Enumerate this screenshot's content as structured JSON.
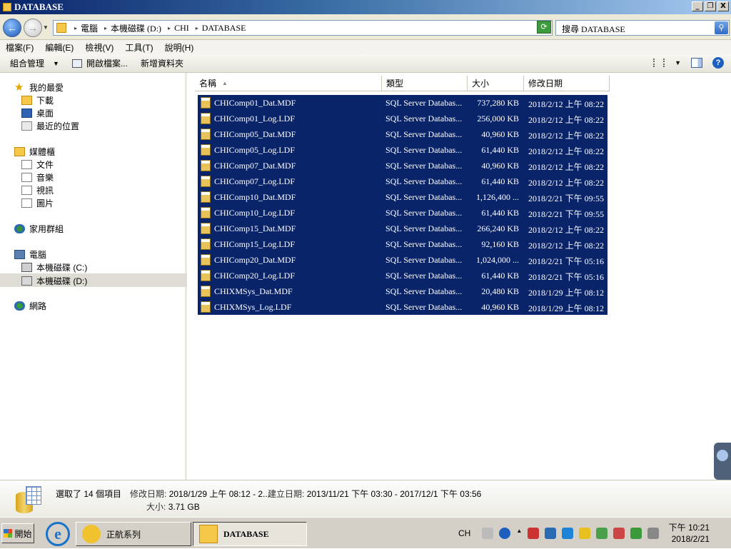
{
  "window": {
    "title": "DATABASE",
    "buttons": [
      "_",
      "❐",
      "X"
    ]
  },
  "address": {
    "crumbs": [
      "電腦",
      "本機磁碟 (D:)",
      "CHI",
      "DATABASE"
    ],
    "search_placeholder": "搜尋 DATABASE"
  },
  "menu": [
    "檔案(F)",
    "編輯(E)",
    "檢視(V)",
    "工具(T)",
    "說明(H)"
  ],
  "commands": {
    "organize": "組合管理",
    "open": "開啟檔案...",
    "new_folder": "新增資料夾"
  },
  "nav": {
    "favorites": "我的最愛",
    "downloads": "下載",
    "desktop": "桌面",
    "recent": "最近的位置",
    "libraries": "媒體櫃",
    "documents": "文件",
    "music": "音樂",
    "videos": "視訊",
    "pictures": "圖片",
    "homegroup": "家用群組",
    "computer": "電腦",
    "drive_c": "本機磁碟 (C:)",
    "drive_d": "本機磁碟 (D:)",
    "network": "網路"
  },
  "columns": {
    "name": "名稱",
    "type": "類型",
    "size": "大小",
    "modified": "修改日期"
  },
  "files": [
    {
      "name": "CHIComp01_Dat.MDF",
      "type": "SQL Server Databas...",
      "size": "737,280 KB",
      "modified": "2018/2/12 上午 08:22"
    },
    {
      "name": "CHIComp01_Log.LDF",
      "type": "SQL Server Databas...",
      "size": "256,000 KB",
      "modified": "2018/2/12 上午 08:22"
    },
    {
      "name": "CHIComp05_Dat.MDF",
      "type": "SQL Server Databas...",
      "size": "40,960 KB",
      "modified": "2018/2/12 上午 08:22"
    },
    {
      "name": "CHIComp05_Log.LDF",
      "type": "SQL Server Databas...",
      "size": "61,440 KB",
      "modified": "2018/2/12 上午 08:22"
    },
    {
      "name": "CHIComp07_Dat.MDF",
      "type": "SQL Server Databas...",
      "size": "40,960 KB",
      "modified": "2018/2/12 上午 08:22"
    },
    {
      "name": "CHIComp07_Log.LDF",
      "type": "SQL Server Databas...",
      "size": "61,440 KB",
      "modified": "2018/2/12 上午 08:22"
    },
    {
      "name": "CHIComp10_Dat.MDF",
      "type": "SQL Server Databas...",
      "size": "1,126,400 ...",
      "modified": "2018/2/21 下午 09:55"
    },
    {
      "name": "CHIComp10_Log.LDF",
      "type": "SQL Server Databas...",
      "size": "61,440 KB",
      "modified": "2018/2/21 下午 09:55"
    },
    {
      "name": "CHIComp15_Dat.MDF",
      "type": "SQL Server Databas...",
      "size": "266,240 KB",
      "modified": "2018/2/12 上午 08:22"
    },
    {
      "name": "CHIComp15_Log.LDF",
      "type": "SQL Server Databas...",
      "size": "92,160 KB",
      "modified": "2018/2/12 上午 08:22"
    },
    {
      "name": "CHIComp20_Dat.MDF",
      "type": "SQL Server Databas...",
      "size": "1,024,000 ...",
      "modified": "2018/2/21 下午 05:16"
    },
    {
      "name": "CHIComp20_Log.LDF",
      "type": "SQL Server Databas...",
      "size": "61,440 KB",
      "modified": "2018/2/21 下午 05:16"
    },
    {
      "name": "CHIXMSys_Dat.MDF",
      "type": "SQL Server Databas...",
      "size": "20,480 KB",
      "modified": "2018/1/29 上午 08:12"
    },
    {
      "name": "CHIXMSys_Log.LDF",
      "type": "SQL Server Databas...",
      "size": "40,960 KB",
      "modified": "2018/1/29 上午 08:12"
    }
  ],
  "details": {
    "selected": "選取了 14 個項目",
    "modified_label": "修改日期:",
    "modified_value": "2018/1/29 上午 08:12 - 2...",
    "created_label": "建立日期:",
    "created_value": "2013/11/21 下午 03:30 - 2017/12/1 下午 03:56",
    "size_label": "大小:",
    "size_value": "3.71 GB"
  },
  "taskbar": {
    "start": "開始",
    "app1": "正航系列",
    "app2": "DATABASE",
    "lang": "CH",
    "time": "下午 10:21",
    "date": "2018/2/21"
  }
}
